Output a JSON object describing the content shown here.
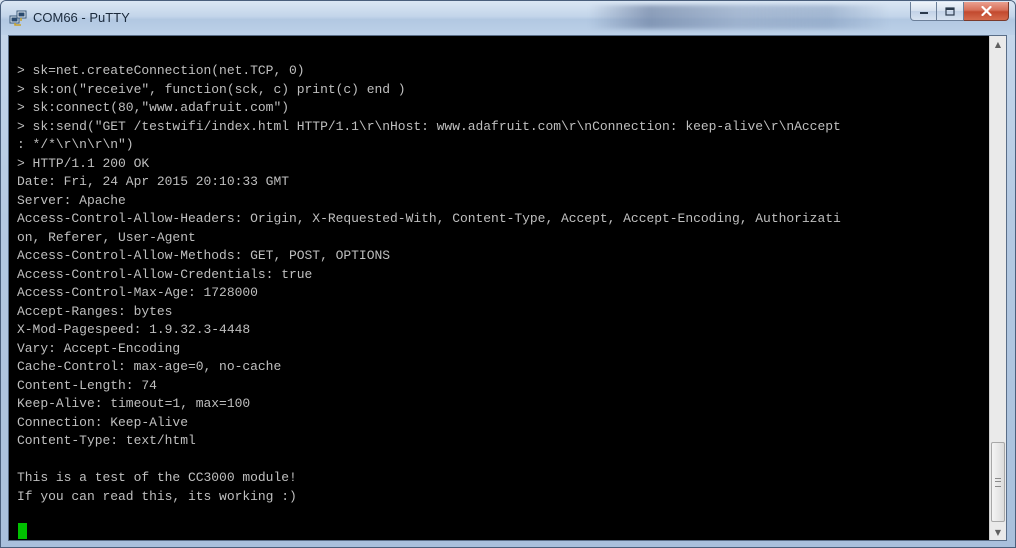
{
  "window": {
    "title": "COM66 - PuTTY",
    "app_icon": "putty-icon"
  },
  "caption_buttons": {
    "minimize_icon": "minimize-icon",
    "maximize_icon": "maximize-icon",
    "close_icon": "close-icon"
  },
  "colors": {
    "terminal_bg": "#000000",
    "terminal_fg": "#bfbfbf",
    "cursor": "#00c000",
    "close_button": "#c24a2f"
  },
  "terminal": {
    "lines": [
      "> sk=net.createConnection(net.TCP, 0)",
      "> sk:on(\"receive\", function(sck, c) print(c) end )",
      "> sk:connect(80,\"www.adafruit.com\")",
      "> sk:send(\"GET /testwifi/index.html HTTP/1.1\\r\\nHost: www.adafruit.com\\r\\nConnection: keep-alive\\r\\nAccept",
      ": */*\\r\\n\\r\\n\")",
      "> HTTP/1.1 200 OK",
      "Date: Fri, 24 Apr 2015 20:10:33 GMT",
      "Server: Apache",
      "Access-Control-Allow-Headers: Origin, X-Requested-With, Content-Type, Accept, Accept-Encoding, Authorizati",
      "on, Referer, User-Agent",
      "Access-Control-Allow-Methods: GET, POST, OPTIONS",
      "Access-Control-Allow-Credentials: true",
      "Access-Control-Max-Age: 1728000",
      "Accept-Ranges: bytes",
      "X-Mod-Pagespeed: 1.9.32.3-4448",
      "Vary: Accept-Encoding",
      "Cache-Control: max-age=0, no-cache",
      "Content-Length: 74",
      "Keep-Alive: timeout=1, max=100",
      "Connection: Keep-Alive",
      "Content-Type: text/html",
      "",
      "This is a test of the CC3000 module!",
      "If you can read this, its working :)"
    ]
  },
  "scrollbar": {
    "up_icon": "scroll-up-arrow-icon",
    "down_icon": "scroll-down-arrow-icon"
  }
}
